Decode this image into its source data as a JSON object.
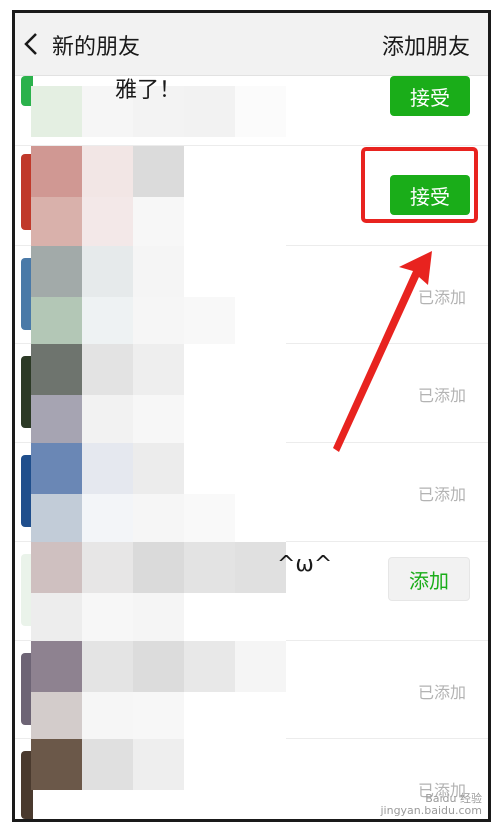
{
  "header": {
    "back_icon": "chevron-left-icon",
    "title": "新的朋友",
    "add_friend_label": "添加朋友"
  },
  "rows": [
    {
      "text": "雅了！",
      "action": "accept",
      "action_label": "接受"
    },
    {
      "text": "",
      "action": "accept",
      "action_label": "接受",
      "highlighted": true
    },
    {
      "text": "",
      "action": "added",
      "action_label": "已添加"
    },
    {
      "text": "",
      "action": "added",
      "action_label": "已添加"
    },
    {
      "text": "",
      "action": "added",
      "action_label": "已添加"
    },
    {
      "text": "^ω^",
      "action": "add",
      "action_label": "添加"
    },
    {
      "text": "",
      "action": "added",
      "action_label": "已添加"
    },
    {
      "text": "",
      "action": "added",
      "action_label": "已添加"
    }
  ],
  "annotation": {
    "highlight_color": "#e8231f",
    "arrow_color": "#e8231f"
  },
  "watermark": {
    "line1": "Baidu 经验",
    "line2": "jingyan.baidu.com"
  },
  "colors": {
    "accent_green": "#1aad19",
    "header_bg": "#f2f2f2"
  }
}
